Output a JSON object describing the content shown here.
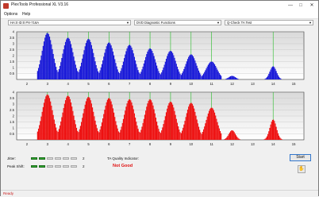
{
  "window": {
    "title": "PlexTools Professional XL V3.16",
    "minimize": "—",
    "maximize": "□",
    "close": "✕"
  },
  "menu": {
    "options": "Options",
    "help": "Help"
  },
  "toolbar": {
    "drive": "HA:0 ID:0  PX-716A",
    "function": "DVD Diagnostic Functions",
    "test": "Q-Check TA Test"
  },
  "chart_data": [
    {
      "type": "bar",
      "title": "",
      "xlabel": "",
      "ylabel": "",
      "x_ticks": [
        2,
        3,
        4,
        5,
        6,
        7,
        8,
        9,
        10,
        11,
        12,
        13,
        14,
        15
      ],
      "y_ticks": [
        4,
        3.5,
        3,
        2.5,
        2,
        1.5,
        1,
        0.5
      ],
      "xlim": [
        1.5,
        15.5
      ],
      "ylim": [
        0,
        4
      ],
      "color": "#1a1ad8",
      "bump_centers": [
        3,
        4,
        5,
        6,
        7,
        8,
        9,
        10,
        11,
        12,
        14
      ],
      "peaks": [
        3.9,
        3.5,
        3.4,
        3.1,
        2.9,
        2.6,
        2.4,
        2.1,
        1.5,
        0.3,
        1.1
      ],
      "green_lines": [
        3,
        4,
        5,
        6,
        7,
        8,
        9,
        10,
        11,
        14
      ]
    },
    {
      "type": "bar",
      "title": "",
      "xlabel": "",
      "ylabel": "",
      "x_ticks": [
        2,
        3,
        4,
        5,
        6,
        7,
        8,
        9,
        10,
        11,
        12,
        13,
        14,
        15
      ],
      "y_ticks": [
        4,
        3.5,
        3,
        2.5,
        2,
        1.5,
        1,
        0.5
      ],
      "xlim": [
        1.5,
        15.5
      ],
      "ylim": [
        0,
        4
      ],
      "color": "#ee1111",
      "bump_centers": [
        3,
        4,
        5,
        6,
        7,
        8,
        9,
        10,
        11,
        12,
        14
      ],
      "peaks": [
        3.8,
        3.7,
        3.6,
        3.5,
        3.4,
        3.4,
        3.2,
        3.1,
        2.7,
        0.8,
        1.7
      ],
      "green_lines": [
        3,
        4,
        5,
        6,
        7,
        8,
        9,
        10,
        11,
        14
      ]
    }
  ],
  "results": {
    "jitter_label": "Jitter:",
    "jitter_value": "2",
    "peak_shift_label": "Peak Shift:",
    "peak_shift_value": "2",
    "quality_label": "TA Quality Indicator:",
    "quality_value": "Not Good",
    "start": "Start"
  },
  "status": {
    "text": "Ready"
  }
}
